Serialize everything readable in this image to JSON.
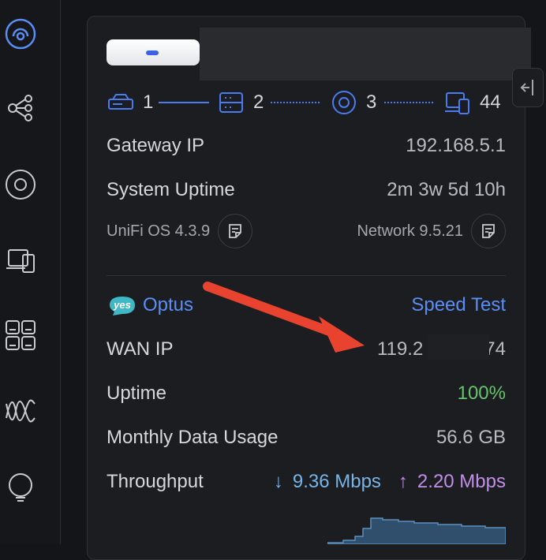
{
  "colors": {
    "accent": "#4a7bf0",
    "link": "#5b8ef5",
    "success": "#65c56a",
    "download": "#7ab4e6",
    "upload": "#c18ee8",
    "arrow": "#e8432f"
  },
  "sidebar": {
    "items": [
      "dashboard-icon",
      "topology-icon",
      "devices-icon",
      "client-devices-icon",
      "ports-icon",
      "wifi-icon",
      "insights-icon"
    ]
  },
  "topology": {
    "gateway_count": "1",
    "switch_count": "2",
    "ap_count": "3",
    "client_count": "44"
  },
  "gateway": {
    "ip_label": "Gateway IP",
    "ip_value": "192.168.5.1",
    "uptime_label": "System Uptime",
    "uptime_value": "2m 3w 5d 10h",
    "os_version": "UniFi OS 4.3.9",
    "network_version": "Network 9.5.21"
  },
  "wan": {
    "isp_badge": "yes",
    "isp_name": "Optus",
    "speed_test_label": "Speed Test",
    "ip_label": "WAN IP",
    "ip_prefix": "119.2",
    "ip_suffix": "74",
    "uptime_label": "Uptime",
    "uptime_value": "100%",
    "data_usage_label": "Monthly Data Usage",
    "data_usage_value": "56.6 GB",
    "throughput_label": "Throughput",
    "download_arrow": "↓",
    "download_value": "9.36 Mbps",
    "upload_arrow": "↑",
    "upload_value": "2.20 Mbps"
  }
}
